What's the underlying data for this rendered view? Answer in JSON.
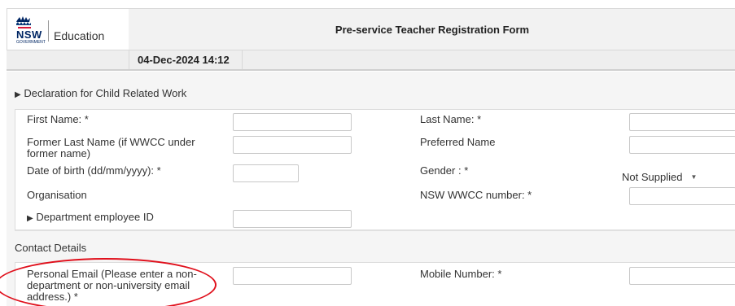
{
  "header": {
    "logo": {
      "wordmark": "NSW",
      "sub": "GOVERNMENT",
      "dept": "Education"
    },
    "title": "Pre-service Teacher Registration Form"
  },
  "datebar": {
    "timestamp": "04-Dec-2024 14:12"
  },
  "declaration": {
    "label": "Declaration for Child Related Work"
  },
  "personal": {
    "first_name_label": "First Name: *",
    "last_name_label": "Last Name: *",
    "former_last_name_label": "Former Last Name (if WWCC under former name)",
    "preferred_name_label": "Preferred Name",
    "dob_label": "Date of birth (dd/mm/yyyy): *",
    "gender_label": "Gender : *",
    "gender_value": "Not Supplied",
    "organisation_label": "Organisation",
    "wwcc_label": "NSW WWCC number: *",
    "employee_id_label": "Department employee ID"
  },
  "contact": {
    "heading": "Contact Details",
    "personal_email_label": "Personal Email (Please enter a non-department or non-university email address.) *",
    "mobile_label": "Mobile Number: *"
  },
  "colors": {
    "highlight": "#e0101c",
    "brand": "#002664"
  }
}
